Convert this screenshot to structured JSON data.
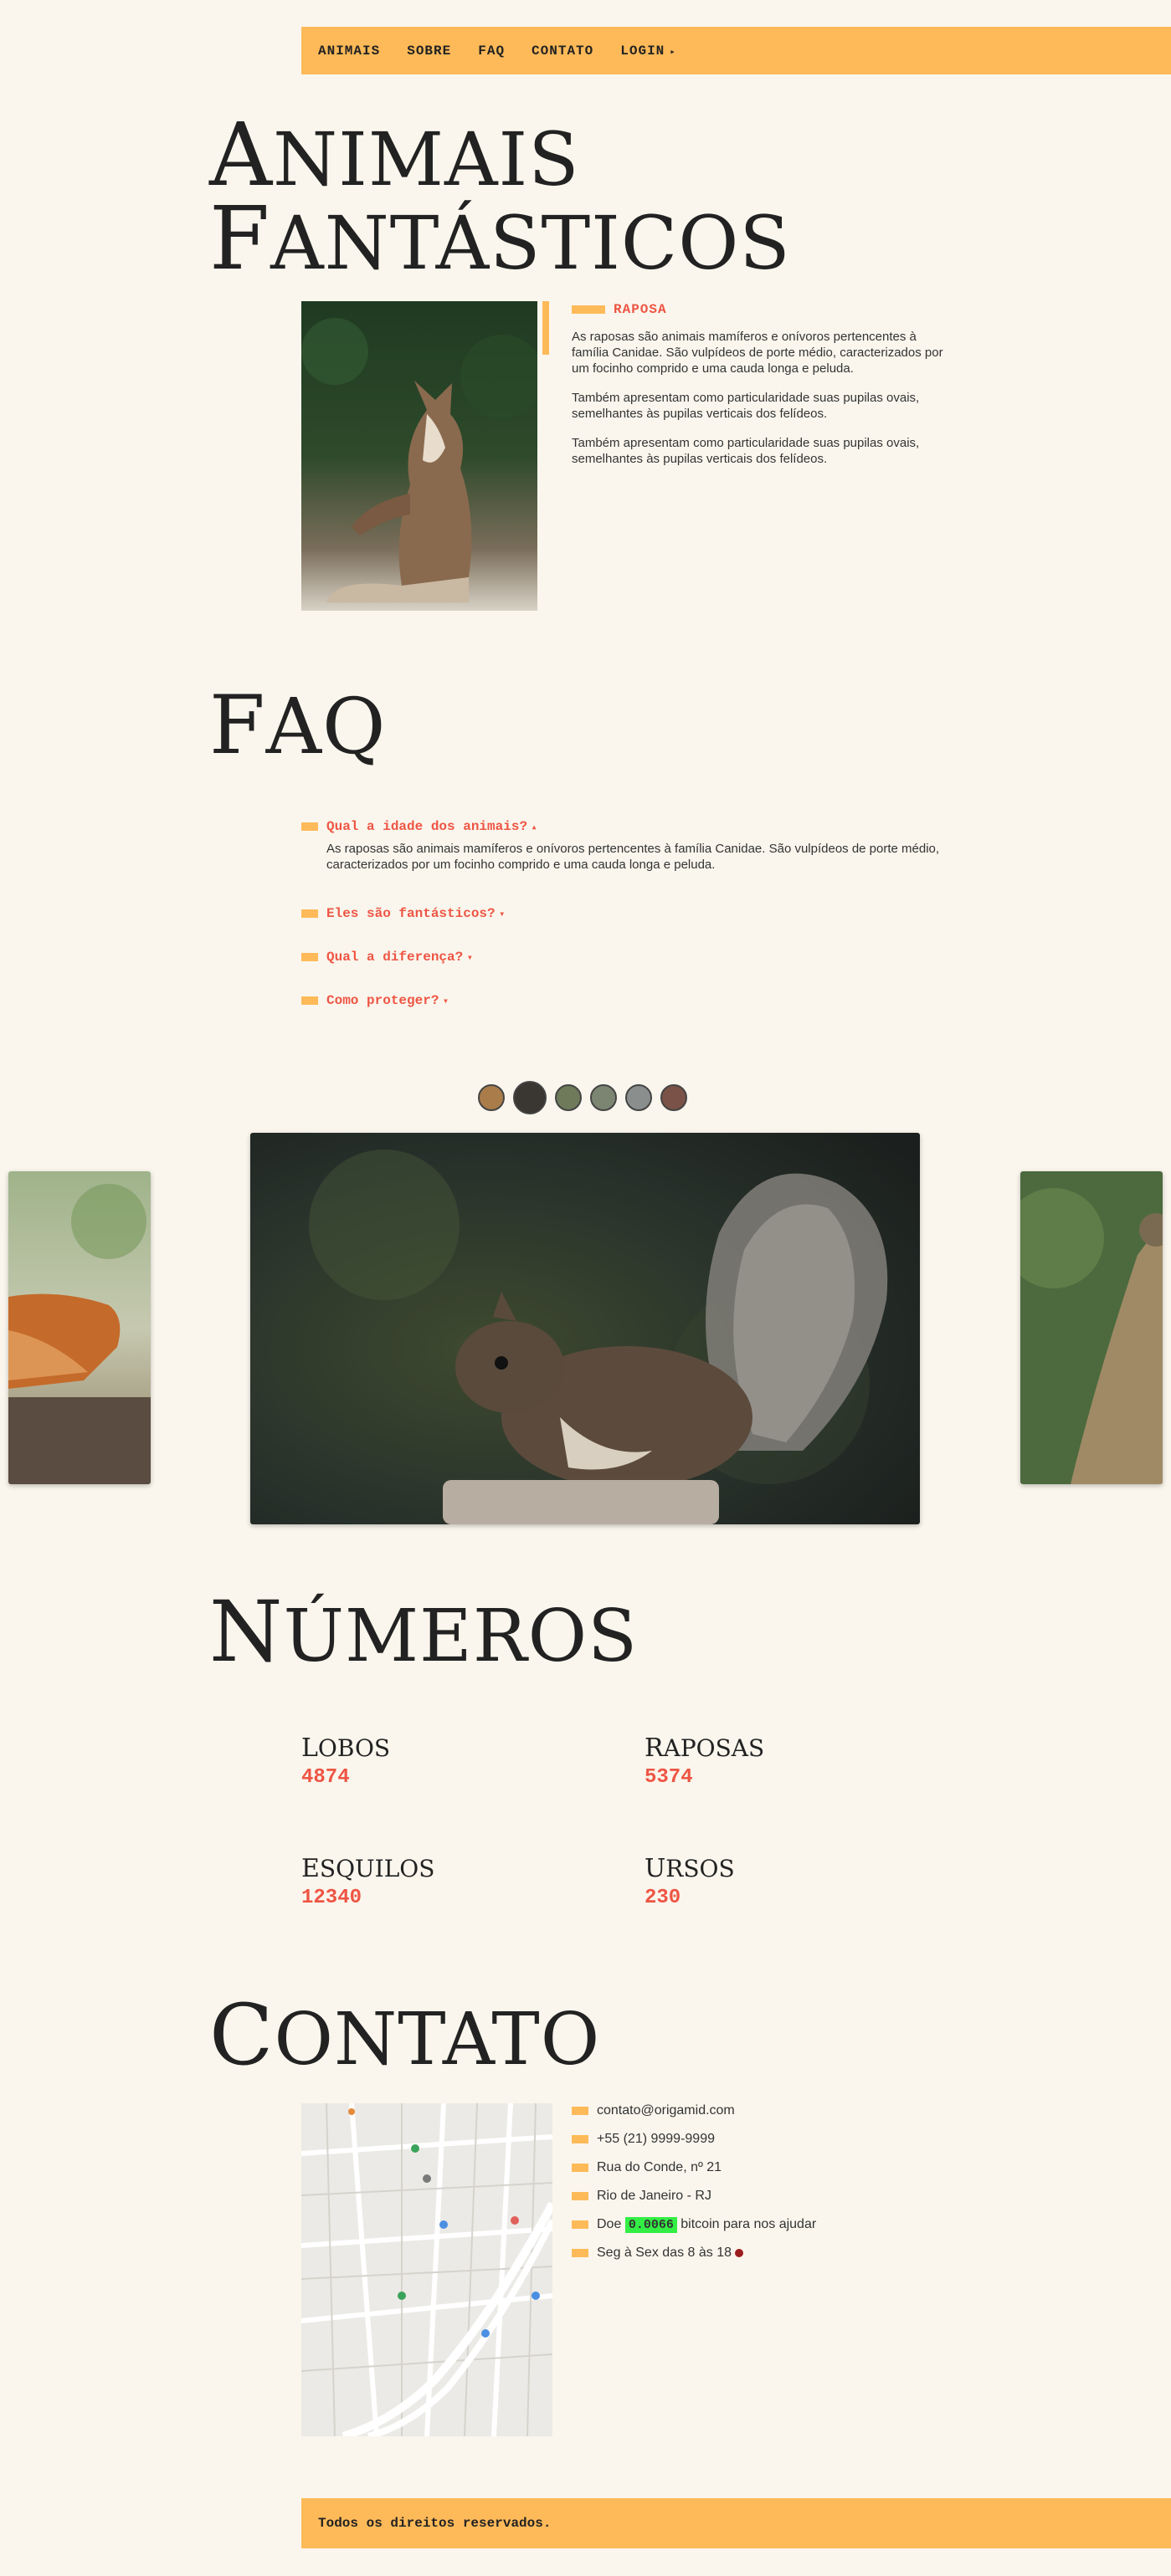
{
  "menu": {
    "items": [
      {
        "label": "ANIMAIS"
      },
      {
        "label": "SOBRE"
      },
      {
        "label": "FAQ"
      },
      {
        "label": "CONTATO"
      },
      {
        "label": "LOGIN"
      }
    ],
    "login_arrow": "▸"
  },
  "hero": {
    "title_line1_cap": "A",
    "title_line1_rest": "NIMAIS",
    "title_line2_cap": "F",
    "title_line2_rest": "ANTÁSTICOS"
  },
  "animal": {
    "name": "RAPOSA",
    "paragraphs": [
      "As raposas são animais mamíferos e onívoros pertencentes à família Canidae. São vulpídeos de porte médio, caracterizados por um focinho comprido e uma cauda longa e peluda.",
      "Também apresentam como particularidade suas pupilas ovais, semelhantes às pupilas verticais dos felídeos.",
      "Também apresentam como particularidade suas pupilas ovais, semelhantes às pupilas verticais dos felídeos."
    ]
  },
  "faq": {
    "title_cap": "F",
    "title_rest": "AQ",
    "items": [
      {
        "question": "Qual a idade dos animais?",
        "arrow": "▴",
        "answer": "As raposas são animais mamíferos e onívoros pertencentes à família Canidae. São vulpídeos de porte médio, caracterizados por um focinho comprido e uma cauda longa e peluda."
      },
      {
        "question": "Eles são fantásticos?",
        "arrow": "▾"
      },
      {
        "question": "Qual a diferença?",
        "arrow": "▾"
      },
      {
        "question": "Como proteger?",
        "arrow": "▾"
      }
    ]
  },
  "numeros": {
    "title_cap": "N",
    "title_rest": "ÚMEROS",
    "items": [
      {
        "cap": "L",
        "rest": "OBOS",
        "value": "4874"
      },
      {
        "cap": "R",
        "rest": "APOSAS",
        "value": "5374"
      },
      {
        "cap": "E",
        "rest": "SQUILOS",
        "value": "12340"
      },
      {
        "cap": "U",
        "rest": "RSOS",
        "value": "230"
      }
    ]
  },
  "contato": {
    "title_cap": "C",
    "title_rest": "ONTATO",
    "email": "contato@origamid.com",
    "phone": "+55 (21) 9999-9999",
    "address": "Rua do Conde, nº 21",
    "city": "Rio de Janeiro - RJ",
    "donate_prefix": "Doe",
    "bitcoin_value": "0.0066",
    "donate_suffix": "bitcoin para nos ajudar",
    "hours": "Seg à Sex das 8 às 18"
  },
  "footer": {
    "text": "Todos os direitos reservados."
  },
  "colors": {
    "accent": "#feba59",
    "highlight_text": "#ee5544",
    "background": "#faf6ed",
    "bitcoin_bg": "#33ee44"
  }
}
